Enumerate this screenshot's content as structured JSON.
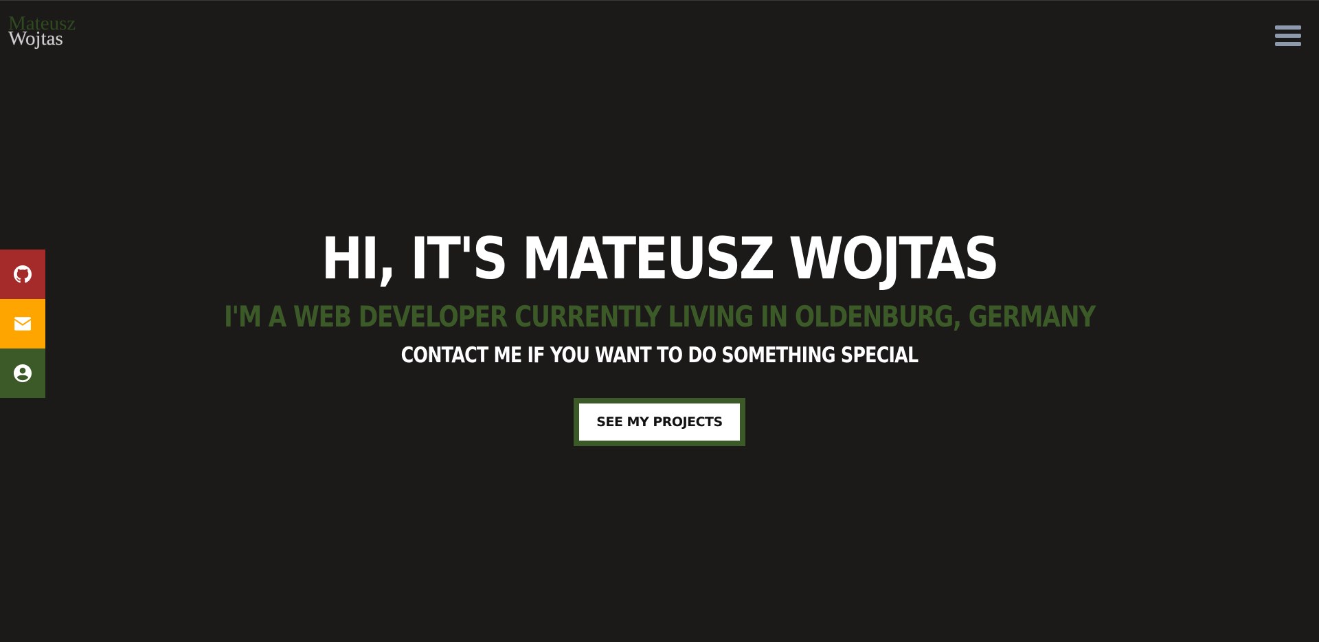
{
  "logo": {
    "first_name": "Mateusz",
    "last_name": "Wojtas"
  },
  "nav": {
    "menu_icon": "hamburger-menu-icon"
  },
  "social": [
    {
      "name": "github",
      "icon": "github-icon",
      "color": "#a52a2a"
    },
    {
      "name": "email",
      "icon": "envelope-icon",
      "color": "#ffa500"
    },
    {
      "name": "about",
      "icon": "user-circle-icon",
      "color": "#3c5a28"
    }
  ],
  "hero": {
    "heading": "Hi, it's Mateusz Wojtas",
    "subheading": "I'm a web developer currently living in Oldenburg, Germany",
    "tagline": "Contact me if you want to do something special",
    "cta_label": "See my projects"
  },
  "colors": {
    "background": "#1b1a19",
    "accent_green": "#3c5a28",
    "menu_icon": "#8d99ad"
  }
}
